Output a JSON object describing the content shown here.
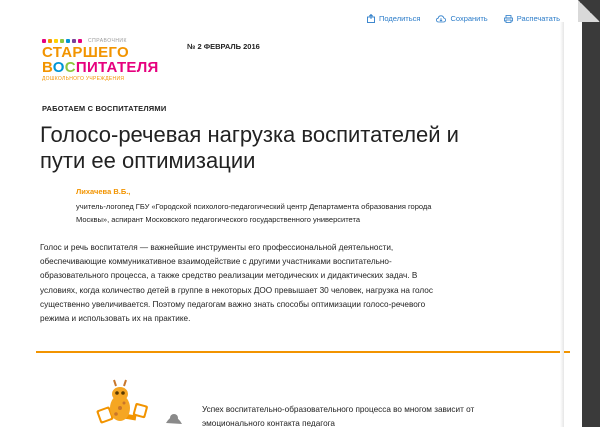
{
  "toolbar": {
    "print_label": "Поделиться",
    "save_label": "Сохранить",
    "print2_label": "Распечатать"
  },
  "logo": {
    "small_text": "СПРАВОЧНИК",
    "line1": "СТАРШЕГО",
    "line2_parts": [
      "В",
      "О",
      "С",
      "ПИТАТЕЛЯ"
    ],
    "subtitle": "ДОШКОЛЬНОГО УЧРЕЖДЕНИЯ"
  },
  "issue": "№ 2 ФЕВРАЛЬ 2016",
  "rubric": "РАБОТАЕМ С ВОСПИТАТЕЛЯМИ",
  "title": "Голосо-речевая нагрузка воспитателей и пути ее оптимизации",
  "author": {
    "name": "Лихачева В.Б.,",
    "info": "учитель-логопед ГБУ «Городской психолого-педагогический центр Департамента образования города Москвы», аспирант Московского педагогического государственного университета"
  },
  "lead": "Голос и речь воспитателя — важнейшие инструменты его профессиональной деятельности, обеспечивающие коммуникативное взаимодействие с другими участниками воспитательно-образовательного процесса, а также средство реализации методических и дидактических задач. В условиях, когда количество детей в группе в некоторых ДОО превышает 30 человек, нагрузка на голос существенно увеличивается. Поэтому педагогам важно знать способы оптимизации голосо-речевого режима и использовать их на практике.",
  "body": "Успех воспитательно-образовательного процесса во многом зависит от эмоционального контакта педагога",
  "colors": {
    "accent_orange": "#f29400",
    "link_blue": "#2b7cc9",
    "magenta": "#e6007e"
  }
}
